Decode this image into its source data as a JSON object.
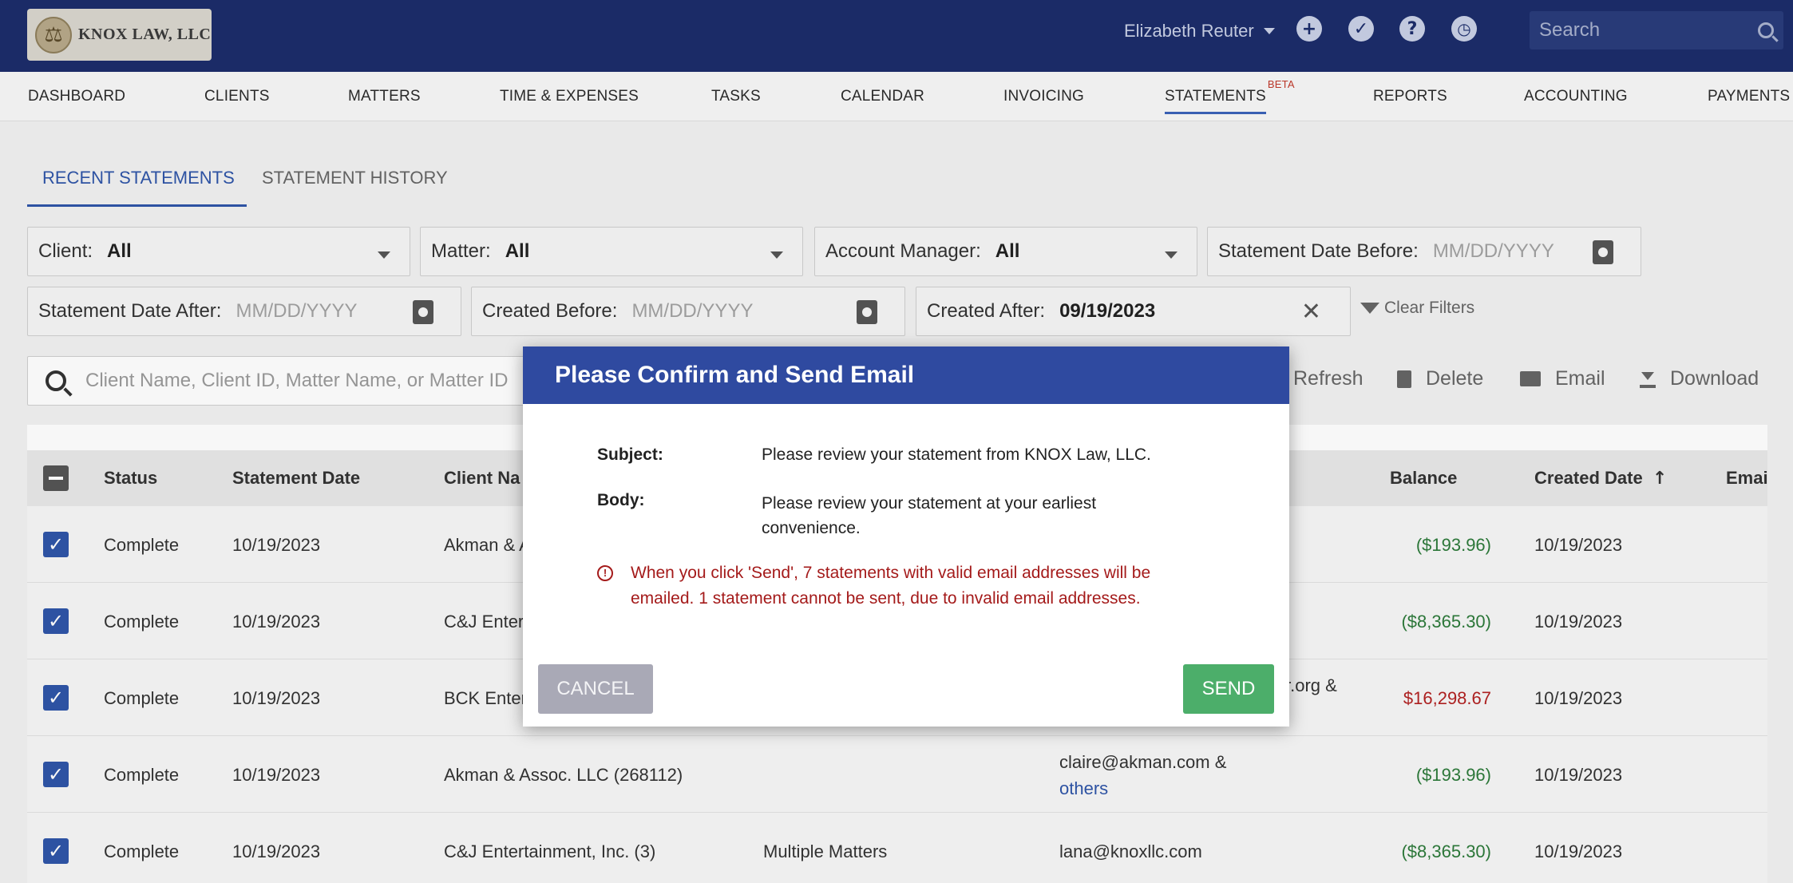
{
  "header": {
    "logo_text": "KNOX LAW, LLC",
    "user_name": "Elizabeth Reuter",
    "search_placeholder": "Search",
    "icons": [
      "plus-icon",
      "check-icon",
      "help-icon",
      "clock-icon",
      "search-icon"
    ]
  },
  "nav": {
    "items": [
      "DASHBOARD",
      "CLIENTS",
      "MATTERS",
      "TIME & EXPENSES",
      "TASKS",
      "CALENDAR",
      "INVOICING",
      "STATEMENTS",
      "REPORTS",
      "ACCOUNTING",
      "PAYMENTS"
    ],
    "active": "STATEMENTS",
    "beta_label": "BETA"
  },
  "subtabs": {
    "recent": "RECENT STATEMENTS",
    "history": "STATEMENT HISTORY"
  },
  "filters": {
    "client_label": "Client:",
    "client_value": "All",
    "matter_label": "Matter:",
    "matter_value": "All",
    "account_manager_label": "Account Manager:",
    "account_manager_value": "All",
    "statement_before_label": "Statement Date Before:",
    "statement_before_placeholder": "MM/DD/YYYY",
    "statement_after_label": "Statement Date After:",
    "statement_after_placeholder": "MM/DD/YYYY",
    "created_before_label": "Created Before:",
    "created_before_placeholder": "MM/DD/YYYY",
    "created_after_label": "Created After:",
    "created_after_value": "09/19/2023",
    "clear_filters": "Clear Filters"
  },
  "search": {
    "placeholder": "Client Name, Client ID, Matter Name, or Matter ID"
  },
  "actions": {
    "refresh": "Refresh",
    "delete": "Delete",
    "email": "Email",
    "download": "Download"
  },
  "table": {
    "columns": {
      "status": "Status",
      "statement_date": "Statement Date",
      "client_name": "Client Na",
      "balance": "Balance",
      "created_date": "Created Date",
      "email": "Emai"
    },
    "rows": [
      {
        "status": "Complete",
        "statement_date": "10/19/2023",
        "client": "Akman & A",
        "matter": "",
        "email": "",
        "email_more": "",
        "balance": "($193.96)",
        "balance_color": "green",
        "created": "10/19/2023"
      },
      {
        "status": "Complete",
        "statement_date": "10/19/2023",
        "client": "C&J Enter",
        "matter": "",
        "email": "",
        "email_more": "",
        "balance": "($8,365.30)",
        "balance_color": "green",
        "created": "10/19/2023"
      },
      {
        "status": "Complete",
        "statement_date": "10/19/2023",
        "client": "BCK Enter",
        "matter": "",
        "email": "r.org &",
        "email_more": "",
        "balance": "$16,298.67",
        "balance_color": "red",
        "created": "10/19/2023"
      },
      {
        "status": "Complete",
        "statement_date": "10/19/2023",
        "client": "Akman & Assoc. LLC (268112)",
        "matter": "",
        "email": "claire@akman.com &",
        "email_more": "others",
        "balance": "($193.96)",
        "balance_color": "green",
        "created": "10/19/2023"
      },
      {
        "status": "Complete",
        "statement_date": "10/19/2023",
        "client": "C&J Entertainment, Inc. (3)",
        "matter": "Multiple Matters",
        "email": "lana@knoxllc.com",
        "email_more": "",
        "balance": "($8,365.30)",
        "balance_color": "green",
        "created": "10/19/2023"
      }
    ]
  },
  "modal": {
    "title": "Please Confirm and Send Email",
    "subject_label": "Subject:",
    "subject_value": "Please review your statement from KNOX Law, LLC.",
    "body_label": "Body:",
    "body_line1": "Please review your statement at your earliest",
    "body_line2": "convenience.",
    "warning_line1": "When you click 'Send', 7 statements with valid email addresses will be",
    "warning_line2": "emailed. 1 statement cannot be sent, due to invalid email addresses.",
    "cancel": "CANCEL",
    "send": "SEND"
  },
  "colors": {
    "header_bg": "#1c2d6b",
    "modal_header": "#2f4aa0",
    "accent": "#2f55a8",
    "send_button": "#4cae6a",
    "warning": "#a41a1a",
    "positive": "#2d7a3a",
    "negative": "#b22222"
  }
}
